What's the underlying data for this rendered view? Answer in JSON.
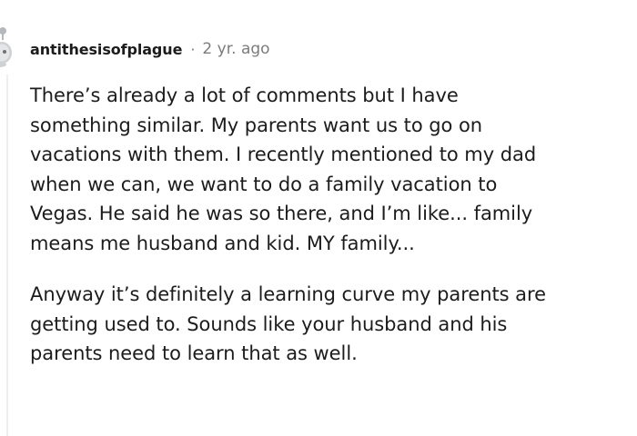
{
  "comment": {
    "author": "antithesisofplague",
    "separator": "·",
    "timestamp": "2 yr. ago",
    "avatar_icon": "snoo-avatar-icon",
    "paragraphs": [
      {
        "lines": [
          "There’s already a lot of comments but I have",
          "something similar. My parents want us to go on",
          "vacations with them. I recently mentioned to my dad",
          "when we can, we want to do a family vacation to",
          "Vegas. He said he was so there, and I’m like... family",
          "means me husband and kid. MY family..."
        ]
      },
      {
        "lines": [
          "Anyway it’s definitely a learning curve my parents are",
          "getting used to. Sounds like your husband and his",
          "parents need to learn that as well."
        ]
      }
    ]
  },
  "colors": {
    "text": "#1c1c1c",
    "meta": "#7c7c7c",
    "avatar": "#b5b9bd",
    "thread_line": "#edeff1"
  }
}
